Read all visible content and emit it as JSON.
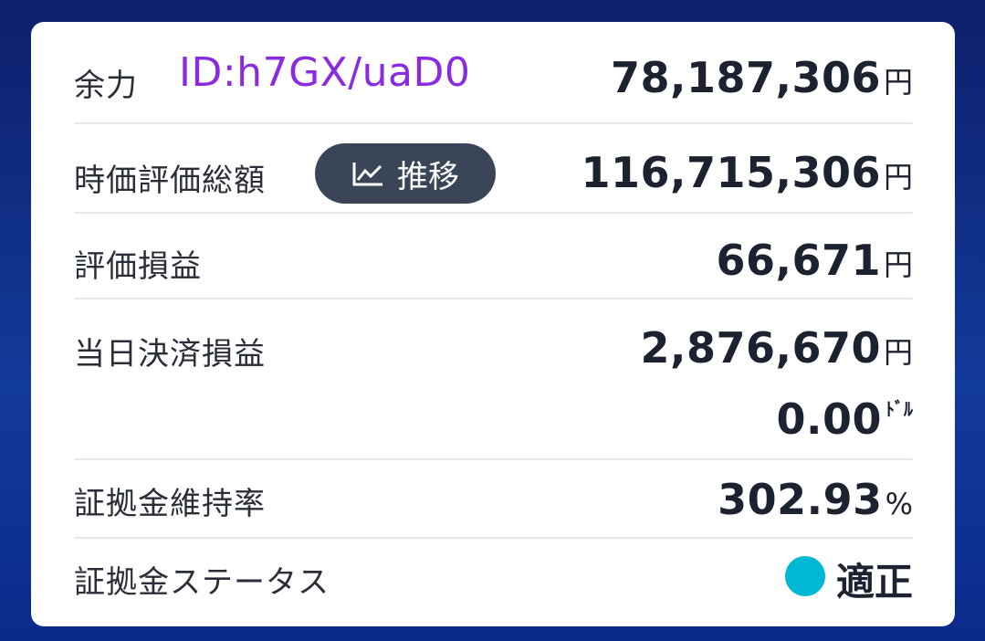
{
  "rows": {
    "available": {
      "label": "余力",
      "id_text": "ID:h7GX/uaD0",
      "value": "78,187,306",
      "unit": "円"
    },
    "market_value": {
      "label": "時価評価総額",
      "trend_button_label": "推移",
      "value": "116,715,306",
      "unit": "円"
    },
    "unrealized_pl": {
      "label": "評価損益",
      "value": "66,671",
      "unit": "円"
    },
    "daily_settled_pl": {
      "label": "当日決済損益",
      "value_yen": "2,876,670",
      "unit_yen": "円",
      "value_usd": "0.00",
      "unit_usd": "ﾄﾞﾙ"
    },
    "margin_ratio": {
      "label": "証拠金維持率",
      "value": "302.93",
      "unit": "%"
    },
    "margin_status": {
      "label": "証拠金ステータス",
      "status": "適正",
      "status_color": "#00b8d4"
    }
  },
  "icons": {
    "trend": "line-chart-icon"
  }
}
